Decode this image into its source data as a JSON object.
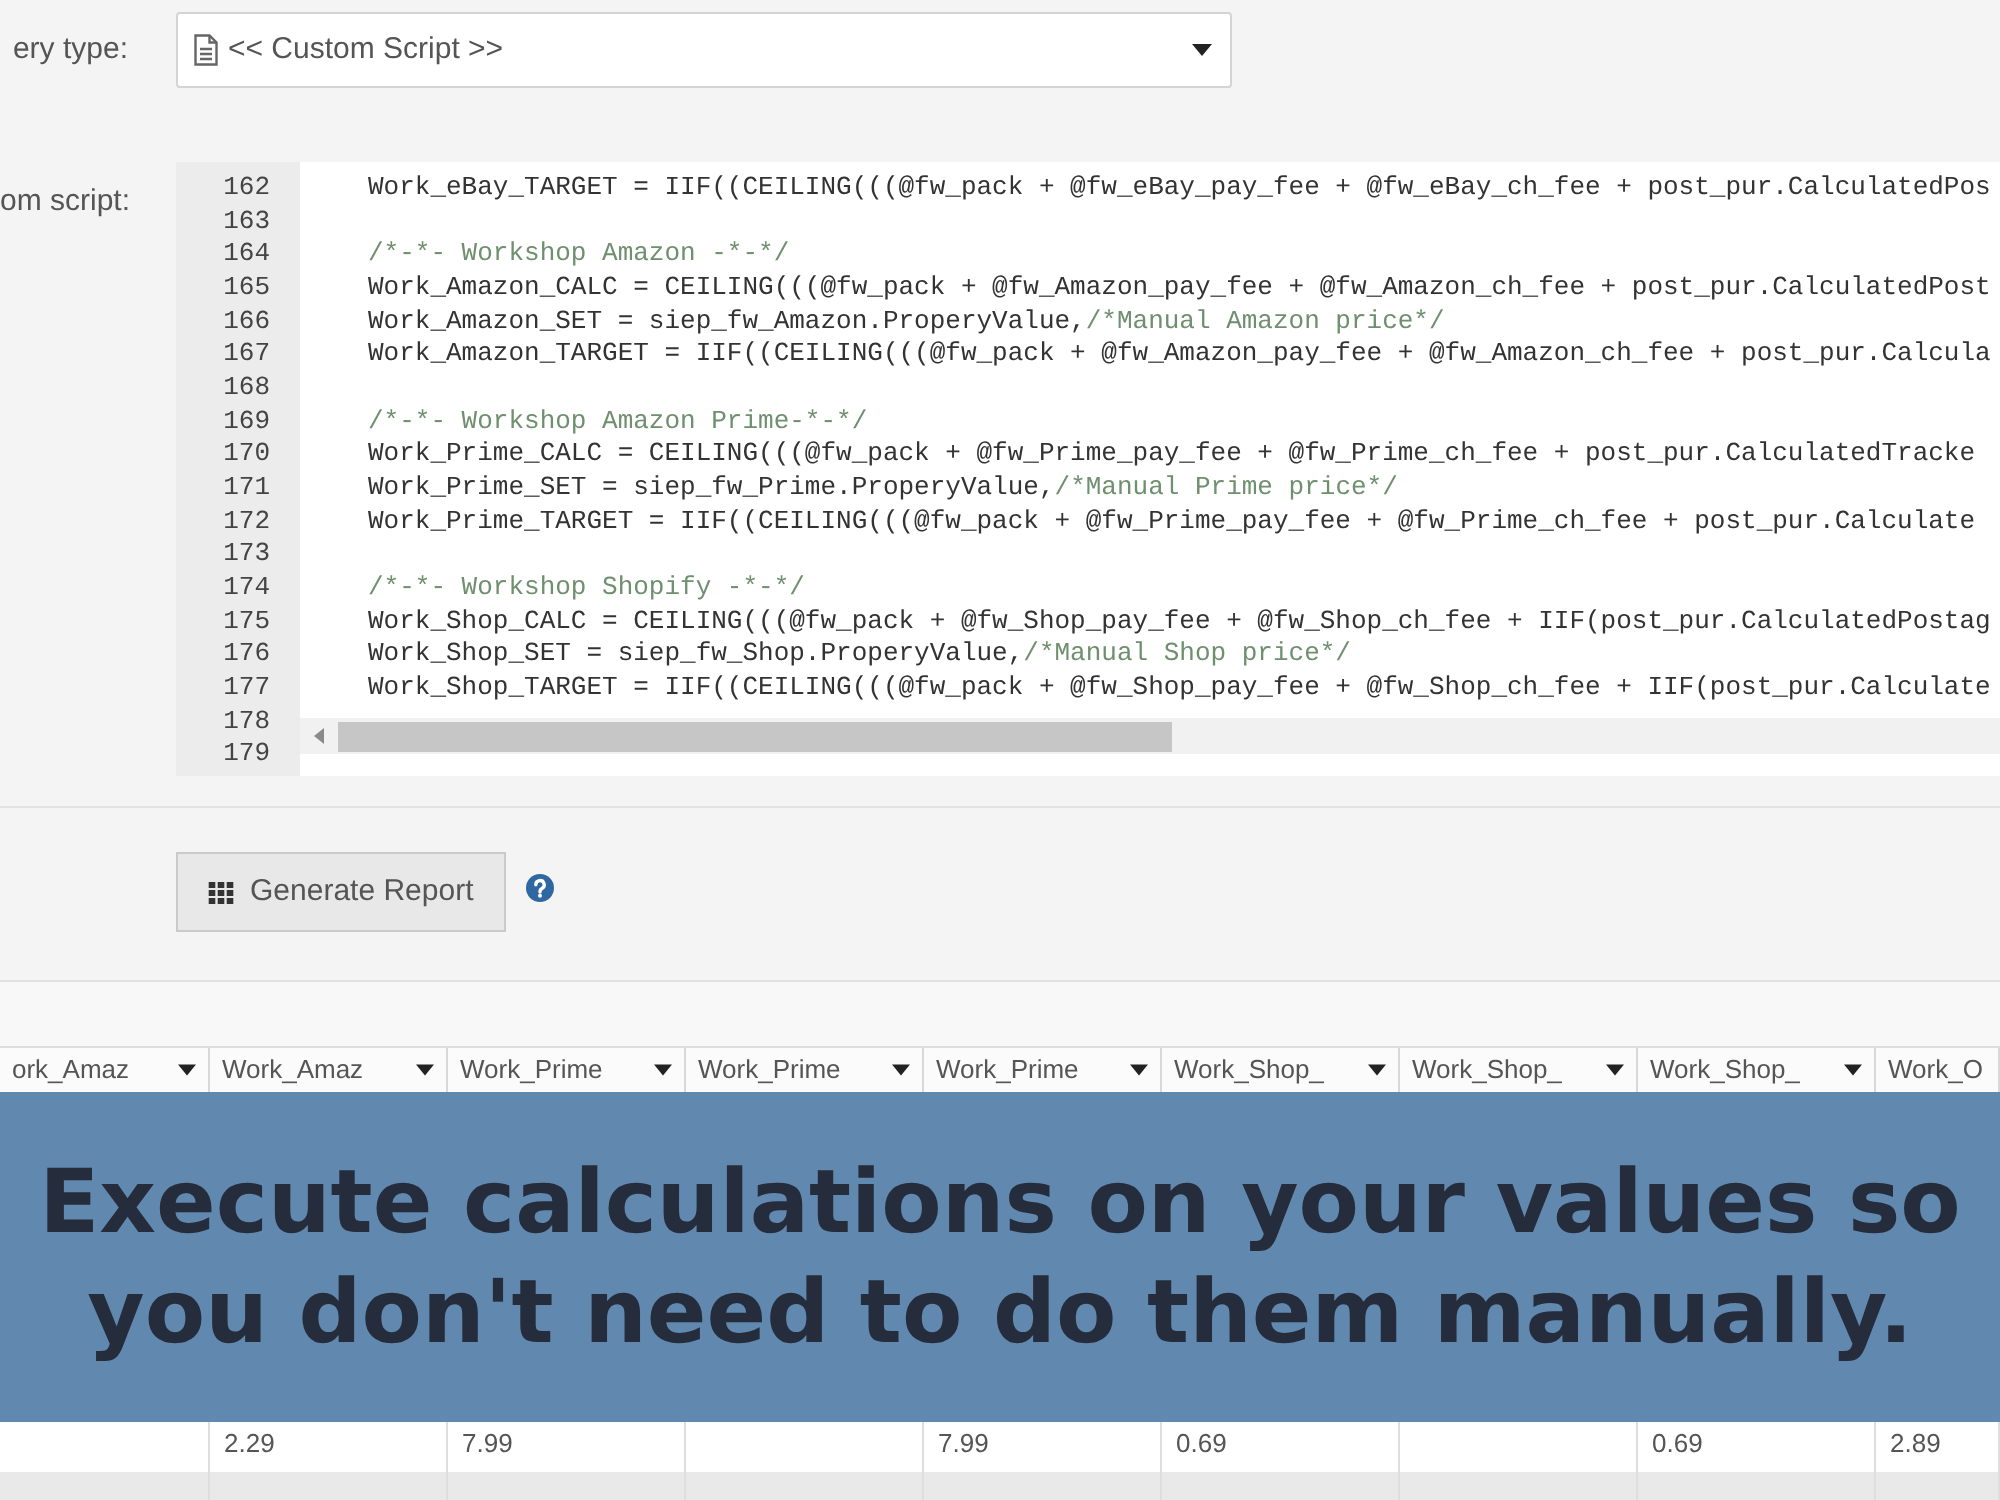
{
  "query_type": {
    "label": "ery type:",
    "value": "<< Custom Script >>"
  },
  "custom_script": {
    "label": "om script:",
    "lines": [
      {
        "number": "162",
        "code": "Work_eBay_TARGET = IIF((CEILING(((@fw_pack + @fw_eBay_pay_fee + @fw_eBay_ch_fee + post_pur.CalculatedPos"
      },
      {
        "number": "163"
      },
      {
        "number": "164",
        "comment": "/*-*- Workshop Amazon -*-*/"
      },
      {
        "number": "165",
        "code": "Work_Amazon_CALC = CEILING(((@fw_pack + @fw_Amazon_pay_fee + @fw_Amazon_ch_fee + post_pur.CalculatedPost"
      },
      {
        "number": "166",
        "code": "Work_Amazon_SET = siep_fw_Amazon.ProperyValue,",
        "comment": "/*Manual Amazon price*/"
      },
      {
        "number": "167",
        "code": "Work_Amazon_TARGET = IIF((CEILING(((@fw_pack + @fw_Amazon_pay_fee + @fw_Amazon_ch_fee + post_pur.Calcula"
      },
      {
        "number": "168"
      },
      {
        "number": "169",
        "comment": "/*-*- Workshop Amazon Prime-*-*/"
      },
      {
        "number": "170",
        "code": "Work_Prime_CALC = CEILING(((@fw_pack + @fw_Prime_pay_fee + @fw_Prime_ch_fee + post_pur.CalculatedTracke"
      },
      {
        "number": "171",
        "code": "Work_Prime_SET = siep_fw_Prime.ProperyValue,",
        "comment": "/*Manual Prime price*/"
      },
      {
        "number": "172",
        "code": "Work_Prime_TARGET = IIF((CEILING(((@fw_pack + @fw_Prime_pay_fee + @fw_Prime_ch_fee + post_pur.Calculate"
      },
      {
        "number": "173"
      },
      {
        "number": "174",
        "comment": "/*-*- Workshop Shopify -*-*/"
      },
      {
        "number": "175",
        "code": "Work_Shop_CALC = CEILING(((@fw_pack + @fw_Shop_pay_fee + @fw_Shop_ch_fee + IIF(post_pur.CalculatedPostag"
      },
      {
        "number": "176",
        "code": "Work_Shop_SET = siep_fw_Shop.ProperyValue,",
        "comment": "/*Manual Shop price*/"
      },
      {
        "number": "177",
        "code": "Work_Shop_TARGET = IIF((CEILING(((@fw_pack + @fw_Shop_pay_fee + @fw_Shop_ch_fee + IIF(post_pur.Calculate"
      },
      {
        "number": "178"
      },
      {
        "number": "179"
      }
    ]
  },
  "generate_button": {
    "label": "Generate Report"
  },
  "table": {
    "columns": [
      "ork_Amaz",
      "Work_Amaz",
      "Work_Prime",
      "Work_Prime",
      "Work_Prime",
      "Work_Shop_",
      "Work_Shop_",
      "Work_Shop_",
      "Work_O"
    ],
    "rows": [
      {
        "shaded": false,
        "cells": [
          null,
          "2.29",
          "7.99",
          null,
          "7.99",
          "0.69",
          null,
          "0.69",
          "2.89"
        ]
      },
      {
        "shaded": true
      }
    ]
  },
  "banner": {
    "text": "Execute calculations on your values so you don't need to do them manually."
  }
}
